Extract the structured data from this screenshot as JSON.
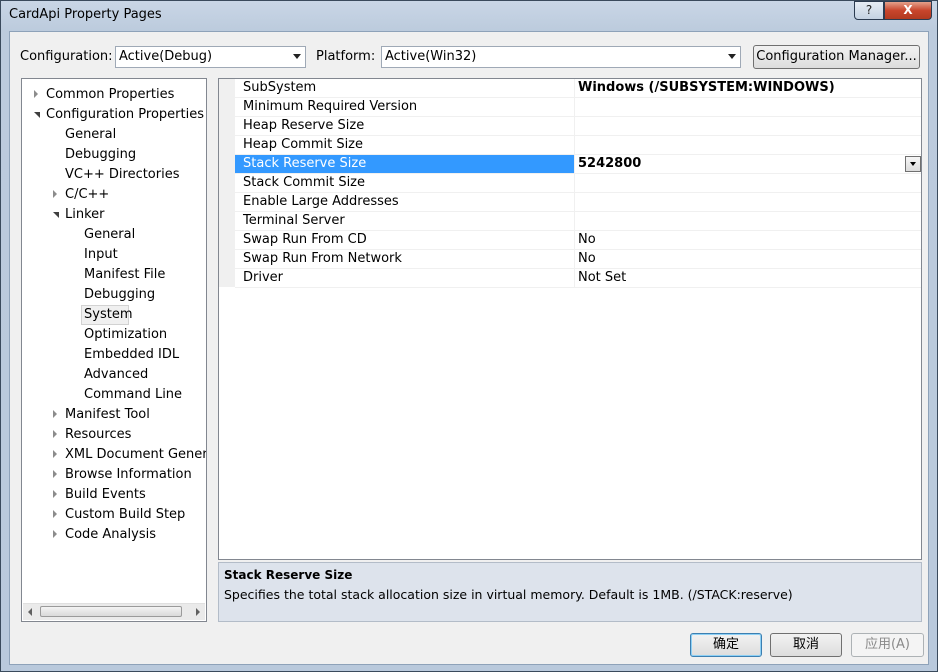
{
  "window": {
    "title": "CardApi Property Pages",
    "help_label": "?",
    "close_label": "X"
  },
  "toolbar": {
    "configuration_label": "Configuration:",
    "configuration_value": "Active(Debug)",
    "platform_label": "Platform:",
    "platform_value": "Active(Win32)",
    "config_manager_label": "Configuration Manager..."
  },
  "tree": {
    "nodes": [
      {
        "label": "Common Properties",
        "expander": "collapsed",
        "level": 0
      },
      {
        "label": "Configuration Properties",
        "expander": "expanded",
        "level": 0
      },
      {
        "label": "General",
        "expander": "none",
        "level": 1
      },
      {
        "label": "Debugging",
        "expander": "none",
        "level": 1
      },
      {
        "label": "VC++ Directories",
        "expander": "none",
        "level": 1
      },
      {
        "label": "C/C++",
        "expander": "collapsed",
        "level": 1
      },
      {
        "label": "Linker",
        "expander": "expanded",
        "level": 1
      },
      {
        "label": "General",
        "expander": "none",
        "level": 2
      },
      {
        "label": "Input",
        "expander": "none",
        "level": 2
      },
      {
        "label": "Manifest File",
        "expander": "none",
        "level": 2
      },
      {
        "label": "Debugging",
        "expander": "none",
        "level": 2
      },
      {
        "label": "System",
        "expander": "none",
        "level": 2,
        "selected": true
      },
      {
        "label": "Optimization",
        "expander": "none",
        "level": 2
      },
      {
        "label": "Embedded IDL",
        "expander": "none",
        "level": 2
      },
      {
        "label": "Advanced",
        "expander": "none",
        "level": 2
      },
      {
        "label": "Command Line",
        "expander": "none",
        "level": 2
      },
      {
        "label": "Manifest Tool",
        "expander": "collapsed",
        "level": 1
      },
      {
        "label": "Resources",
        "expander": "collapsed",
        "level": 1
      },
      {
        "label": "XML Document Generat",
        "expander": "collapsed",
        "level": 1
      },
      {
        "label": "Browse Information",
        "expander": "collapsed",
        "level": 1
      },
      {
        "label": "Build Events",
        "expander": "collapsed",
        "level": 1
      },
      {
        "label": "Custom Build Step",
        "expander": "collapsed",
        "level": 1
      },
      {
        "label": "Code Analysis",
        "expander": "collapsed",
        "level": 1
      }
    ]
  },
  "properties": [
    {
      "name": "SubSystem",
      "value": "Windows (/SUBSYSTEM:WINDOWS)",
      "bold": true
    },
    {
      "name": "Minimum Required Version",
      "value": ""
    },
    {
      "name": "Heap Reserve Size",
      "value": ""
    },
    {
      "name": "Heap Commit Size",
      "value": ""
    },
    {
      "name": "Stack Reserve Size",
      "value": "5242800",
      "bold": true,
      "selected": true
    },
    {
      "name": "Stack Commit Size",
      "value": ""
    },
    {
      "name": "Enable Large Addresses",
      "value": ""
    },
    {
      "name": "Terminal Server",
      "value": ""
    },
    {
      "name": "Swap Run From CD",
      "value": "No"
    },
    {
      "name": "Swap Run From Network",
      "value": "No"
    },
    {
      "name": "Driver",
      "value": "Not Set"
    }
  ],
  "description": {
    "title": "Stack Reserve Size",
    "text": "Specifies the total stack allocation size in virtual memory. Default is 1MB.     (/STACK:reserve)"
  },
  "buttons": {
    "ok": "确定",
    "cancel": "取消",
    "apply": "应用(A)"
  },
  "colors": {
    "selection": "#3399ff",
    "window_frame": "#bccbdd",
    "client": "#f0f0f0",
    "description_bg": "#dde3ec"
  }
}
